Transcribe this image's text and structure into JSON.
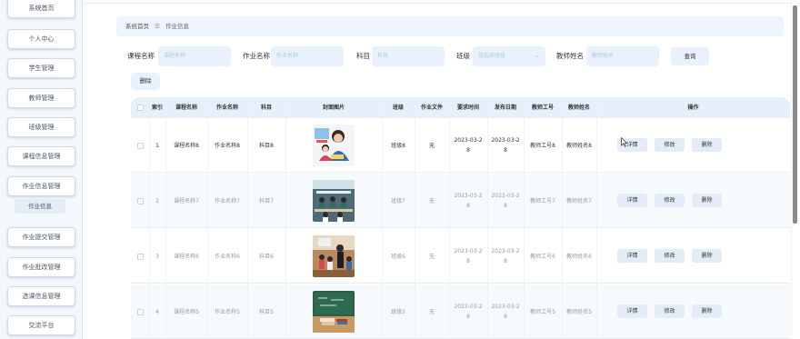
{
  "sidebar": {
    "items": [
      {
        "label": "系统首页"
      },
      {
        "label": "个人中心"
      },
      {
        "label": "学生管理"
      },
      {
        "label": "教师管理"
      },
      {
        "label": "班级管理"
      },
      {
        "label": "课程信息管理"
      },
      {
        "label": "作业信息管理"
      },
      {
        "label": "作业提交管理"
      },
      {
        "label": "作业批改管理"
      },
      {
        "label": "选课信息管理"
      },
      {
        "label": "交流平台"
      }
    ],
    "sub_item": "作业信息"
  },
  "breadcrumb": {
    "home": "系统首页",
    "sep": "☰",
    "current": "作业信息"
  },
  "filters": {
    "course_label": "课程名称",
    "course_placeholder": "课程名称",
    "homework_label": "作业名称",
    "homework_placeholder": "作业名称",
    "subject_label": "科目",
    "subject_placeholder": "科目",
    "class_label": "班级",
    "class_placeholder": "请选择班级",
    "teacher_label": "教师姓名",
    "teacher_placeholder": "教师姓名",
    "search_label": "查询"
  },
  "actions": {
    "delete_label": "删除"
  },
  "table": {
    "headers": [
      "",
      "索引",
      "课程名称",
      "作业名称",
      "科目",
      "封面图片",
      "班级",
      "作业文件",
      "要求时间",
      "发布日期",
      "教师工号",
      "教师姓名",
      "操作"
    ],
    "rows": [
      {
        "index": "1",
        "course": "课程名称8",
        "homework": "作业名称8",
        "subject": "科目8",
        "class": "班级8",
        "file": "无",
        "required": "2023-03-2\n8",
        "published": "2023-03-2\n8",
        "teacher_no": "教师工号8",
        "teacher_name": "教师姓名8"
      },
      {
        "index": "2",
        "course": "课程名称7",
        "homework": "作业名称7",
        "subject": "科目7",
        "class": "班级7",
        "file": "无",
        "required": "2023-03-2\n8",
        "published": "2023-03-2\n8",
        "teacher_no": "教师工号7",
        "teacher_name": "教师姓名7"
      },
      {
        "index": "3",
        "course": "课程名称6",
        "homework": "作业名称6",
        "subject": "科目6",
        "class": "班级6",
        "file": "无",
        "required": "2023-03-2\n8",
        "published": "2023-03-2\n8",
        "teacher_no": "教师工号6",
        "teacher_name": "教师姓名6"
      },
      {
        "index": "4",
        "course": "课程名称5",
        "homework": "作业名称5",
        "subject": "科目5",
        "class": "班级5",
        "file": "无",
        "required": "2023-03-2\n8",
        "published": "2023-03-2\n8",
        "teacher_no": "教师工号5",
        "teacher_name": "教师姓名5"
      }
    ],
    "row_actions": {
      "detail": "详情",
      "edit": "修改",
      "delete": "删除"
    }
  },
  "colors": {
    "accent_bg": "#e9f2fc",
    "header_bg": "#e6effa",
    "sidebar_bg": "#f4f7fb"
  }
}
